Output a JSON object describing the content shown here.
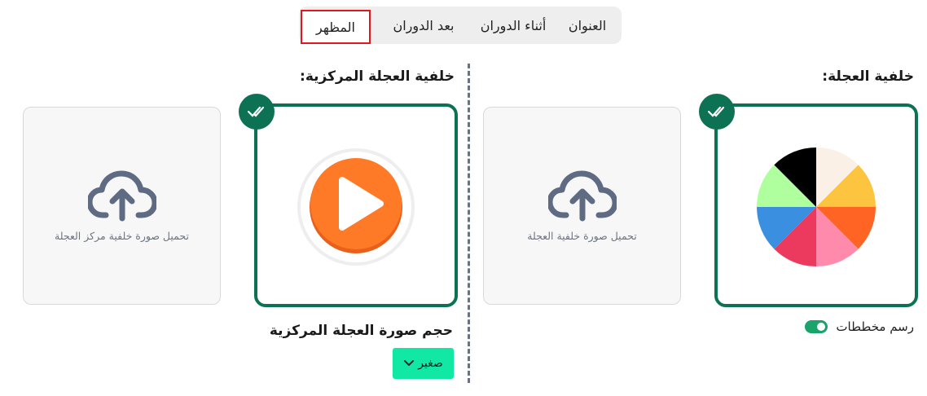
{
  "tabs": [
    {
      "label": "المظهر",
      "active": true
    },
    {
      "label": "بعد الدوران",
      "active": false
    },
    {
      "label": "أثناء الدوران",
      "active": false
    },
    {
      "label": "العنوان",
      "active": false
    }
  ],
  "wheel_background": {
    "heading": "خلفية العجلة:",
    "upload_label": "تحميل صورة خلفية العجلة",
    "toggle_label": "رسم مخططات",
    "toggle_on": true,
    "segment_colors": [
      "#fbf0e6",
      "#fdc53f",
      "#ff6424",
      "#ff8aab",
      "#eb3a5e",
      "#3a8fe1",
      "#b0ff9e",
      "#000000"
    ]
  },
  "center_background": {
    "heading": "خلفية العجلة المركزية:",
    "upload_label": "تحميل صورة خلفية مركز العجلة",
    "size_heading": "حجم صورة العجلة المركزية",
    "size_value": "صغير"
  },
  "colors": {
    "accent_green": "#0d7254",
    "active_tab_border": "#e3161b",
    "dropdown_bg": "#11e8a4",
    "play_orange": "#ff7a26"
  }
}
